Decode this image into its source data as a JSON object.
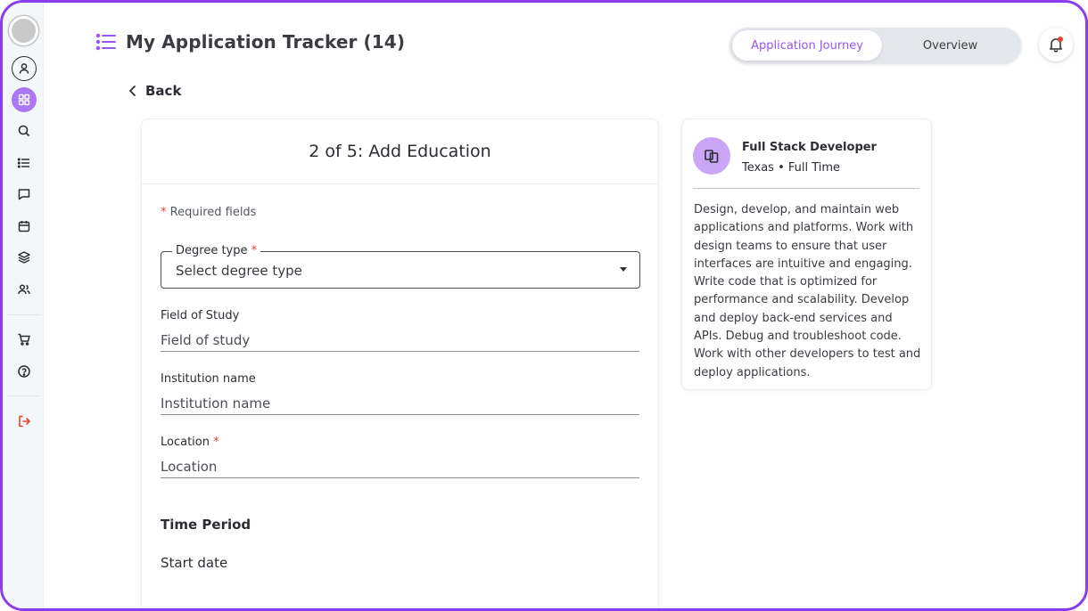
{
  "header": {
    "title": "My Application Tracker (14)",
    "tabs": [
      {
        "label": "Application Journey",
        "active": true
      },
      {
        "label": "Overview",
        "active": false
      }
    ]
  },
  "nav": {
    "back_label": "Back"
  },
  "sidebar": {
    "items": [
      {
        "icon": "user-icon"
      },
      {
        "icon": "grid-icon",
        "active": true
      },
      {
        "icon": "search-icon"
      },
      {
        "icon": "list-icon"
      },
      {
        "icon": "chat-icon"
      },
      {
        "icon": "calendar-icon"
      },
      {
        "icon": "layers-icon"
      },
      {
        "icon": "users-icon"
      },
      {
        "icon": "cart-icon"
      },
      {
        "icon": "help-icon"
      },
      {
        "icon": "logout-icon"
      }
    ]
  },
  "form": {
    "title": "2 of 5: Add Education",
    "required_star": "*",
    "required_note": "Required fields",
    "degree": {
      "label": "Degree type",
      "required": "*",
      "value": "Select degree type"
    },
    "field_of_study": {
      "label": "Field of Study",
      "placeholder": "Field of study"
    },
    "institution": {
      "label": "Institution name",
      "placeholder": "Institution name"
    },
    "location": {
      "label": "Location",
      "required": "*",
      "placeholder": "Location"
    },
    "time_period": "Time Period",
    "start_date": "Start date"
  },
  "job": {
    "title": "Full Stack Developer",
    "meta": "Texas • Full Time",
    "description": "Design, develop, and maintain web applications and platforms. Work with design teams to ensure that user interfaces are intuitive and engaging. Write code that is optimized for performance and scalability. Develop and deploy back-end services and APIs. Debug and troubleshoot code. Work with other developers to test and deploy applications."
  },
  "colors": {
    "accent": "#9a55f0",
    "frame": "#8a3df0",
    "required": "#e8412d",
    "logout": "#e8412d"
  }
}
